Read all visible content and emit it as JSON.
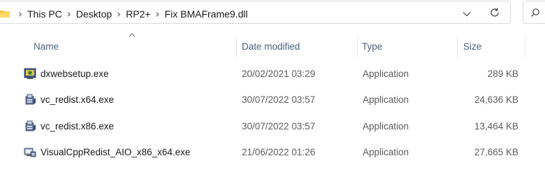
{
  "address_bar": {
    "breadcrumbs": [
      "This PC",
      "Desktop",
      "RP2+",
      "Fix BMAFrame9.dll"
    ]
  },
  "columns": {
    "name": "Name",
    "date_modified": "Date modified",
    "type": "Type",
    "size": "Size"
  },
  "files": [
    {
      "name": "dxwebsetup.exe",
      "date": "20/02/2021 03:29",
      "type": "Application",
      "size": "289 KB",
      "icon": "setup-icon"
    },
    {
      "name": "vc_redist.x64.exe",
      "date": "30/07/2022 03:57",
      "type": "Application",
      "size": "24,636 KB",
      "icon": "installer-icon"
    },
    {
      "name": "vc_redist.x86.exe",
      "date": "30/07/2022 03:57",
      "type": "Application",
      "size": "13,464 KB",
      "icon": "installer-icon"
    },
    {
      "name": "VisualCppRedist_AIO_x86_x64.exe",
      "date": "21/06/2022 01:26",
      "type": "Application",
      "size": "27,665 KB",
      "icon": "app-installer-icon"
    }
  ],
  "colors": {
    "header_text": "#4c607a",
    "meta_text": "#5c5c5c",
    "folder_yellow": "#f5c342"
  }
}
